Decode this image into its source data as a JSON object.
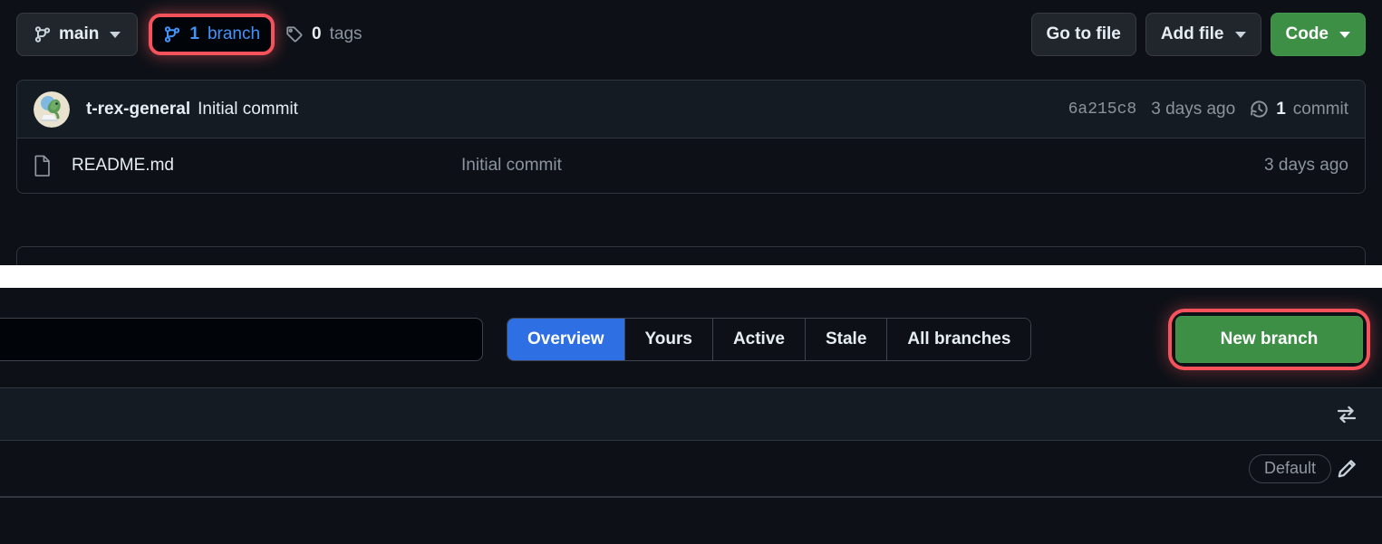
{
  "repo_toolbar": {
    "branch_selector": {
      "label": "main",
      "icon": "git-branch-icon"
    },
    "branch_counter": {
      "count": "1",
      "label": "branch",
      "icon": "git-branch-icon",
      "highlighted": true
    },
    "tag_counter": {
      "count": "0",
      "label": "tags",
      "icon": "tag-icon"
    },
    "go_to_file_label": "Go to file",
    "add_file_label": "Add file",
    "code_label": "Code"
  },
  "commit_row": {
    "avatar_name": "t-rex-general-avatar",
    "author": "t-rex-general",
    "message": "Initial commit",
    "sha": "6a215c8",
    "age": "3 days ago",
    "commit_count": "1",
    "commit_count_label": "commit",
    "history_icon": "clock-history-icon"
  },
  "file_rows": [
    {
      "icon": "file-icon",
      "name": "README.md",
      "commit_message": "Initial commit",
      "age": "3 days ago"
    }
  ],
  "branches_page": {
    "search": {
      "value": "",
      "placeholder": ""
    },
    "tabs": [
      {
        "label": "Overview",
        "active": true
      },
      {
        "label": "Yours",
        "active": false
      },
      {
        "label": "Active",
        "active": false
      },
      {
        "label": "Stale",
        "active": false
      },
      {
        "label": "All branches",
        "active": false
      }
    ],
    "new_branch_label": "New branch",
    "new_branch_highlighted": true,
    "header_row": {
      "compare_icon": "compare-arrows-icon"
    },
    "rows": [
      {
        "badge": "Default",
        "edit_icon": "pencil-icon"
      }
    ]
  },
  "colors": {
    "page_background": "#0d1117",
    "panel_background": "#151b23",
    "border": "#30363d",
    "accent_blue": "#4493f8",
    "tab_active_blue": "#2f6fe4",
    "button_green": "#3d8f45",
    "highlight_red": "#f5525c",
    "text_primary": "#e6edf3",
    "text_muted": "#8b949e"
  }
}
